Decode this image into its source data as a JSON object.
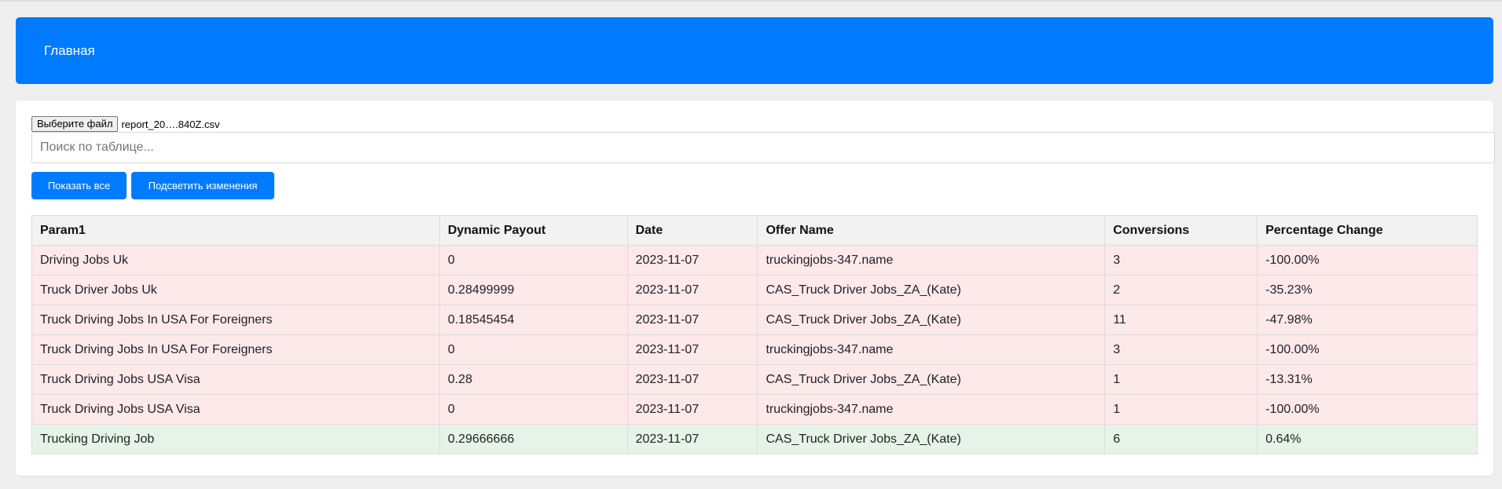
{
  "header": {
    "title": "Главная"
  },
  "file": {
    "button_label": "Выберите файл",
    "file_name": "report_20….840Z.csv"
  },
  "search": {
    "placeholder": "Поиск по таблице..."
  },
  "buttons": {
    "show_all": "Показать все",
    "highlight_changes": "Подсветить изменения"
  },
  "table": {
    "headers": [
      "Param1",
      "Dynamic Payout",
      "Date",
      "Offer Name",
      "Conversions",
      "Percentage Change"
    ],
    "rows": [
      {
        "status": "neg",
        "cells": [
          "Driving Jobs Uk",
          "0",
          "2023-11-07",
          "truckingjobs-347.name",
          "3",
          "-100.00%"
        ]
      },
      {
        "status": "neg",
        "cells": [
          "Truck Driver Jobs Uk",
          "0.28499999",
          "2023-11-07",
          "CAS_Truck Driver Jobs_ZA_(Kate)",
          "2",
          "-35.23%"
        ]
      },
      {
        "status": "neg",
        "cells": [
          "Truck Driving Jobs In USA For Foreigners",
          "0.18545454",
          "2023-11-07",
          "CAS_Truck Driver Jobs_ZA_(Kate)",
          "11",
          "-47.98%"
        ]
      },
      {
        "status": "neg",
        "cells": [
          "Truck Driving Jobs In USA For Foreigners",
          "0",
          "2023-11-07",
          "truckingjobs-347.name",
          "3",
          "-100.00%"
        ]
      },
      {
        "status": "neg",
        "cells": [
          "Truck Driving Jobs USA Visa",
          "0.28",
          "2023-11-07",
          "CAS_Truck Driver Jobs_ZA_(Kate)",
          "1",
          "-13.31%"
        ]
      },
      {
        "status": "neg",
        "cells": [
          "Truck Driving Jobs USA Visa",
          "0",
          "2023-11-07",
          "truckingjobs-347.name",
          "1",
          "-100.00%"
        ]
      },
      {
        "status": "pos",
        "cells": [
          "Trucking Driving Job",
          "0.29666666",
          "2023-11-07",
          "CAS_Truck Driver Jobs_ZA_(Kate)",
          "6",
          "0.64%"
        ]
      }
    ]
  },
  "colors": {
    "accent": "#007bff",
    "negative_row": "#fde8ea",
    "positive_row": "#e6f4e8",
    "header_bg": "#f2f2f2"
  }
}
